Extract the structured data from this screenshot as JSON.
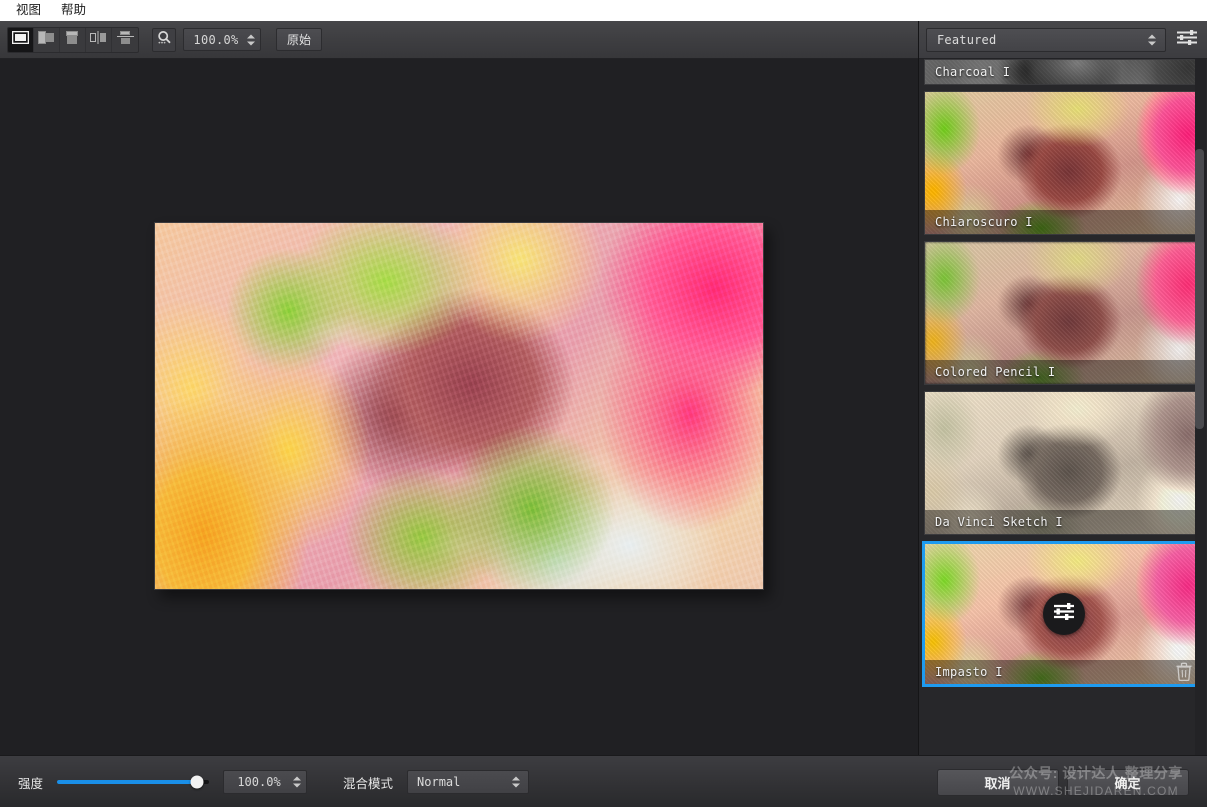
{
  "menubar": {
    "items": [
      {
        "label": "视图",
        "name": "menu-view"
      },
      {
        "label": "帮助",
        "name": "menu-help"
      }
    ]
  },
  "toolbar": {
    "view_modes": [
      {
        "name": "view-single",
        "icon": "single-view-icon",
        "active": true
      },
      {
        "name": "view-split-vertical",
        "icon": "split-vertical-icon",
        "active": false
      },
      {
        "name": "view-split-horizontal",
        "icon": "split-horizontal-icon",
        "active": false
      },
      {
        "name": "view-side-by-side",
        "icon": "side-by-side-icon",
        "active": false
      },
      {
        "name": "view-stacked",
        "icon": "stacked-icon",
        "active": false
      }
    ],
    "zoom_icon": "magnifier-icon",
    "zoom_value": "100.0%",
    "original_label": "原始"
  },
  "right_panel": {
    "category_selected": "Featured",
    "menu_icon": "sliders-icon",
    "presets": [
      {
        "name": "preset-charcoal-1",
        "label": "Charcoal I",
        "style": "gray",
        "selected": false,
        "clipped": true
      },
      {
        "name": "preset-chiaroscuro-1",
        "label": "Chiaroscuro I",
        "style": "vivid",
        "selected": false,
        "clipped": false
      },
      {
        "name": "preset-colored-pencil-1",
        "label": "Colored Pencil I",
        "style": "soft",
        "selected": false,
        "clipped": false
      },
      {
        "name": "preset-da-vinci-sketch-1",
        "label": "Da Vinci Sketch I",
        "style": "sepia",
        "selected": false,
        "clipped": false
      },
      {
        "name": "preset-impasto-1",
        "label": "Impasto I",
        "style": "impasto",
        "selected": true,
        "clipped": false
      }
    ],
    "selected_overlay_icon": "sliders-icon",
    "selected_delete_icon": "trash-icon"
  },
  "bottombar": {
    "intensity_label": "强度",
    "intensity_value": "100.0%",
    "intensity_percent": 92,
    "blend_label": "混合模式",
    "blend_value": "Normal",
    "cancel_label": "取消",
    "confirm_label": "确定"
  },
  "watermark": {
    "line1": "公众号: 设计达人 整理分享",
    "line2": "WWW.SHEJIDAREN.COM"
  },
  "colors": {
    "accent": "#1e9bf0",
    "slider": "#1a8fe8",
    "panel_bg": "#27272a",
    "canvas_bg": "#202023",
    "toolbar_bg": "#3e3e41"
  }
}
